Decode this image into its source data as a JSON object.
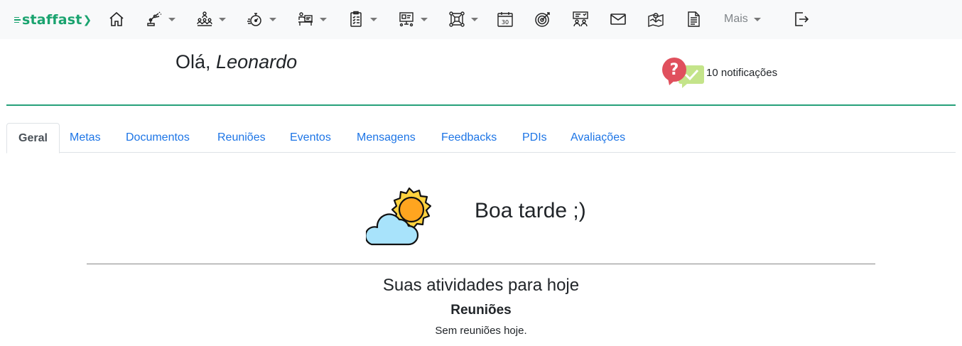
{
  "brand": {
    "name": "staffast",
    "color": "#1aa36f"
  },
  "nav": {
    "items": [
      {
        "icon": "home-icon"
      },
      {
        "icon": "robot-arm-icon",
        "dropdown": true
      },
      {
        "icon": "people-group-icon",
        "dropdown": true
      },
      {
        "icon": "stopwatch-icon",
        "dropdown": true
      },
      {
        "icon": "teacher-board-icon",
        "dropdown": true
      },
      {
        "icon": "checklist-icon",
        "dropdown": true
      },
      {
        "icon": "computer-presentation-icon",
        "dropdown": true
      },
      {
        "icon": "network-nodes-icon",
        "dropdown": true
      },
      {
        "icon": "calendar-icon",
        "text": "30"
      },
      {
        "icon": "target-icon"
      },
      {
        "icon": "meeting-icon"
      },
      {
        "icon": "mail-icon"
      },
      {
        "icon": "map-icon"
      },
      {
        "icon": "document-icon"
      }
    ],
    "more_label": "Mais",
    "logout_icon": "logout-icon"
  },
  "header": {
    "greeting_prefix": "Olá,",
    "user_name": "Leonardo",
    "notifications_label": "10 notificações",
    "notifications_icon": "question-chat-icon"
  },
  "tabs": [
    {
      "label": "Geral",
      "active": true
    },
    {
      "label": "Metas"
    },
    {
      "label": "Documentos"
    },
    {
      "label": "Reuniões"
    },
    {
      "label": "Eventos"
    },
    {
      "label": "Mensagens"
    },
    {
      "label": "Feedbacks"
    },
    {
      "label": "PDIs"
    },
    {
      "label": "Avaliações"
    }
  ],
  "main": {
    "weather_icon": "sun-cloud-icon",
    "greeting": "Boa tarde ;)",
    "activities_title": "Suas atividades para hoje",
    "meetings_heading": "Reuniões",
    "meetings_empty": "Sem reuniões hoje."
  },
  "colors": {
    "accent": "#26a07a",
    "link": "#1d75e6",
    "navbar_bg": "#f8f9fa"
  }
}
